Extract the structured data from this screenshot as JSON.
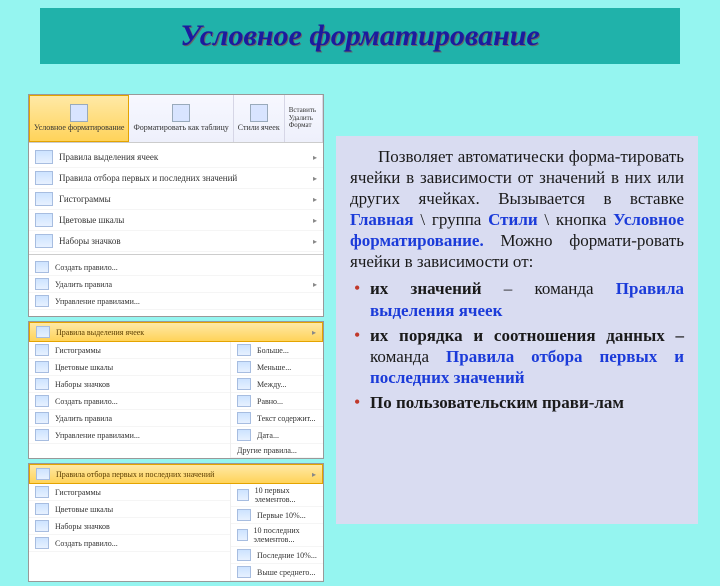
{
  "title": "Условное форматирование",
  "ribbon": {
    "btn1": "Условное форматирование",
    "btn2": "Форматировать как таблицу",
    "btn3": "Стили ячеек",
    "cmd_insert": "Вставить",
    "cmd_delete": "Удалить",
    "cmd_format": "Формат"
  },
  "menu1": {
    "i1": "Правила выделения ячеек",
    "i2": "Правила отбора первых и последних значений",
    "i3": "Гистограммы",
    "i4": "Цветовые шкалы",
    "i5": "Наборы значков",
    "i6": "Создать правило...",
    "i7": "Удалить правила",
    "i8": "Управление правилами..."
  },
  "menu2": {
    "header": "Правила выделения ячеек",
    "l1": "Гистограммы",
    "l2": "Цветовые шкалы",
    "l3": "Наборы значков",
    "l4": "Создать правило...",
    "l5": "Удалить правила",
    "l6": "Управление правилами...",
    "r1": "Больше...",
    "r2": "Меньше...",
    "r3": "Между...",
    "r4": "Равно...",
    "r5": "Текст содержит...",
    "r6": "Дата...",
    "r7": "Другие правила..."
  },
  "menu3": {
    "header": "Правила отбора первых и последних значений",
    "l1": "Гистограммы",
    "l2": "Цветовые шкалы",
    "l3": "Наборы значков",
    "l4": "Создать правило...",
    "r1": "10 первых элементов...",
    "r2": "Первые 10%...",
    "r3": "10 последних элементов...",
    "r4": "Последние 10%...",
    "r5": "Выше среднего..."
  },
  "body": {
    "p1a": "Позволяет автоматически форма-тировать ячейки в зависимости от значений в них или других ячейках. Вызывается в вставке ",
    "p1b": "Главная",
    "p1c": " \\ группа ",
    "p1d": "Стили",
    "p1e": " \\ кнопка ",
    "p1f": "Условное форматирование.",
    "p1g": " Можно формати-ровать ячейки в зависимости от:",
    "li1a": "их значений",
    "li1b": " – команда ",
    "li1c": "Правила выделения ячеек",
    "li2a": "их порядка и соотношения данных –",
    "li2b": " команда ",
    "li2c": "Правила отбора первых и последних значений",
    "li3a": "По пользовательским прави-лам"
  }
}
